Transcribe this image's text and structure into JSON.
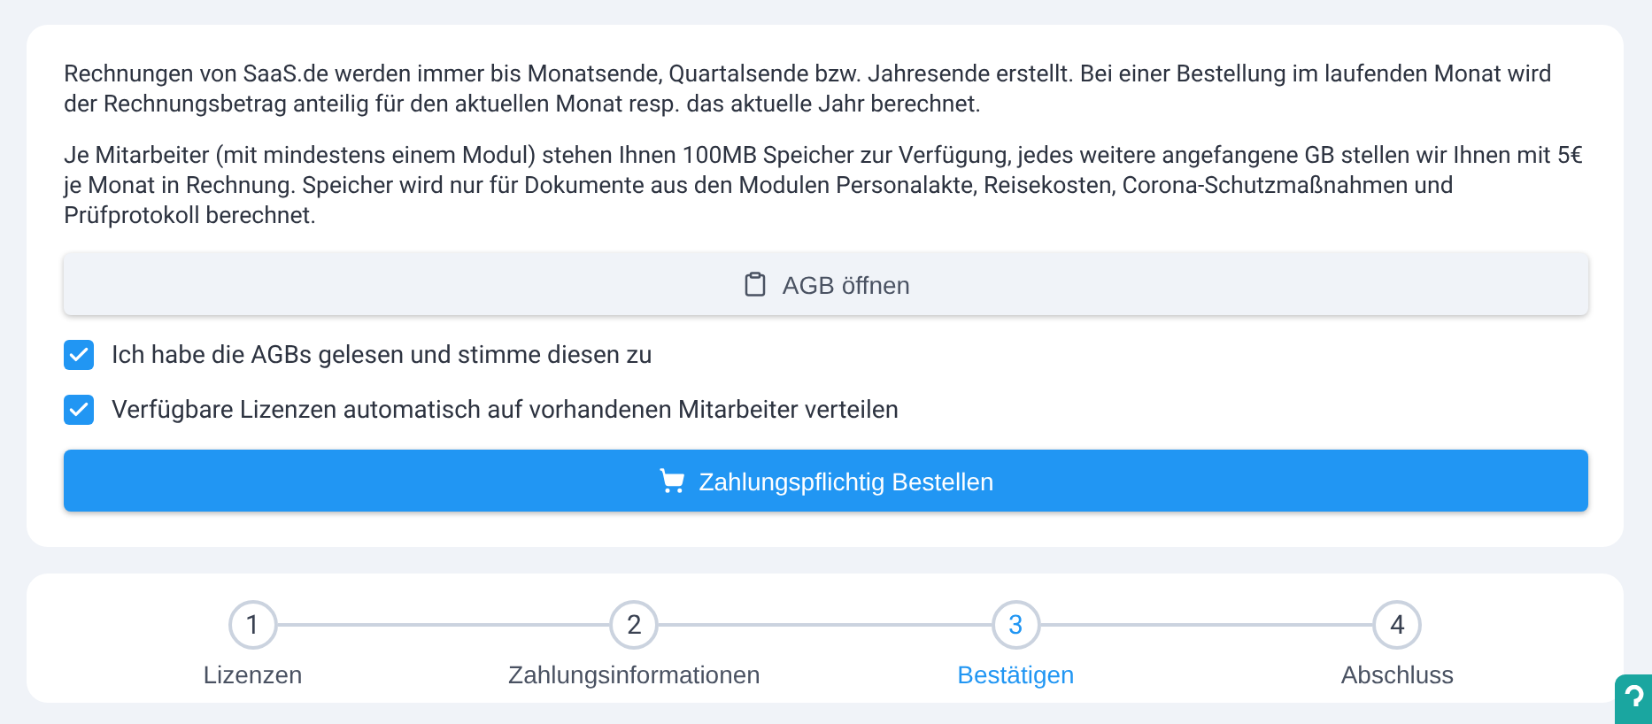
{
  "info_paragraphs": [
    "Rechnungen von SaaS.de werden immer bis Monatsende, Quartalsende bzw. Jahresende erstellt. Bei einer Bestellung im laufenden Monat wird der Rechnungsbetrag anteilig für den aktuellen Monat resp. das aktuelle Jahr berechnet.",
    "Je Mitarbeiter (mit mindestens einem Modul) stehen Ihnen 100MB Speicher zur Verfügung, jedes weitere angefangene GB stellen wir Ihnen mit 5€ je Monat in Rechnung. Speicher wird nur für Dokumente aus den Modulen Personalakte, Reisekosten, Corona-Schutzmaßnahmen und Prüfprotokoll berechnet."
  ],
  "agb_button": "AGB öffnen",
  "checkboxes": [
    {
      "label": "Ich habe die AGBs gelesen und stimme diesen zu",
      "checked": true
    },
    {
      "label": "Verfügbare Lizenzen automatisch auf vorhandenen Mitarbeiter verteilen",
      "checked": true
    }
  ],
  "order_button": "Zahlungspflichtig Bestellen",
  "steps": [
    {
      "number": "1",
      "label": "Lizenzen",
      "selected": false
    },
    {
      "number": "2",
      "label": "Zahlungsinformationen",
      "selected": false
    },
    {
      "number": "3",
      "label": "Bestätigen",
      "selected": true
    },
    {
      "number": "4",
      "label": "Abschluss",
      "selected": false
    }
  ]
}
